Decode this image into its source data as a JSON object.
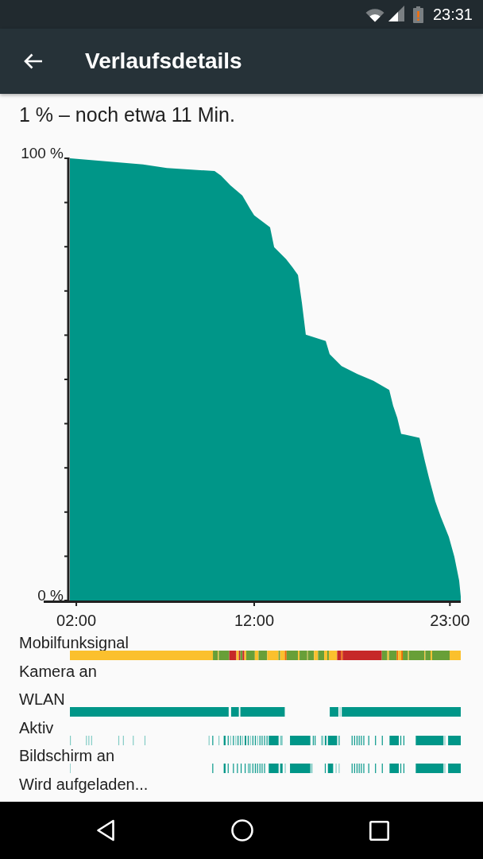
{
  "status_bar": {
    "time": "23:31"
  },
  "toolbar": {
    "title": "Verlaufsdetails"
  },
  "summary": "1 % – noch etwa 11 Min.",
  "chart": {
    "chart_data": {
      "type": "area",
      "x": [
        1.64,
        5.75,
        7.09,
        9.77,
        10.13,
        10.66,
        11.33,
        11.78,
        12.0,
        12.89,
        13.12,
        13.79,
        14.14,
        14.46,
        14.68,
        14.9,
        16.02,
        16.24,
        16.91,
        17.8,
        18.7,
        19.59,
        19.81,
        20.04,
        20.26,
        21.29,
        21.6,
        21.82,
        22.18,
        22.49,
        22.94,
        23.25,
        23.52,
        23.61
      ],
      "series": [
        {
          "color": "#009688",
          "values": [
            100,
            98.6,
            97.8,
            97.1,
            96.1,
            93.9,
            91.6,
            88.5,
            87.1,
            84.4,
            79.9,
            77.2,
            75.4,
            73.6,
            67.3,
            60.1,
            58.7,
            55.7,
            53.0,
            51.2,
            49.7,
            47.6,
            44.0,
            41.3,
            37.7,
            36.8,
            31.4,
            27.8,
            22.4,
            18.9,
            14.4,
            9.9,
            4.5,
            0.9
          ]
        }
      ],
      "xlim": [
        1.64,
        23.61
      ],
      "ylim": [
        0,
        100
      ],
      "xticks": [
        {
          "value": 2,
          "label": "02:00"
        },
        {
          "value": 12,
          "label": "12:00"
        },
        {
          "value": 23,
          "label": "23:00"
        }
      ],
      "yticks": [
        {
          "value": 0,
          "label": "0 %"
        },
        {
          "value": 100,
          "label": "100 %"
        }
      ]
    }
  },
  "tracks": [
    {
      "label": "Mobilfunksignal",
      "kind": "signal"
    },
    {
      "label": "Kamera an",
      "kind": "none"
    },
    {
      "label": "WLAN",
      "kind": "wifi"
    },
    {
      "label": "Aktiv",
      "kind": "awake"
    },
    {
      "label": "Bildschirm an",
      "kind": "screen"
    },
    {
      "label": "Wird aufgeladen...",
      "kind": "none"
    }
  ]
}
